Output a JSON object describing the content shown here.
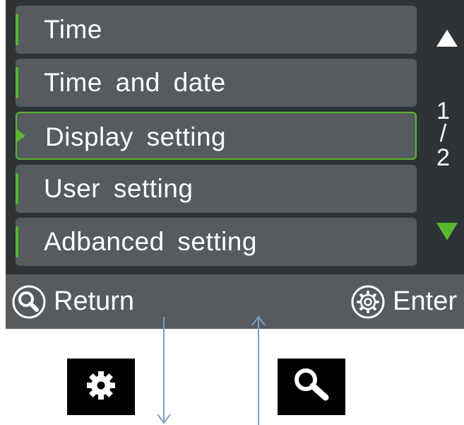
{
  "menu": {
    "items": [
      {
        "label": "Time",
        "selected": false
      },
      {
        "label": "Time and date",
        "selected": false
      },
      {
        "label": "Display setting",
        "selected": true
      },
      {
        "label": "User setting",
        "selected": false
      },
      {
        "label": "Adbanced setting",
        "selected": false
      }
    ]
  },
  "pager": {
    "current": "1",
    "separator": "/",
    "total": "2"
  },
  "footer": {
    "return_label": "Return",
    "return_icon": "search-icon",
    "enter_label": "Enter",
    "enter_icon": "gear-icon"
  },
  "hardware_buttons": {
    "left_icon": "gear-icon",
    "right_icon": "search-icon"
  },
  "colors": {
    "background": "#2e3337",
    "item": "#565b5f",
    "accent": "#59b52d",
    "arrow": "#7da0c4"
  }
}
